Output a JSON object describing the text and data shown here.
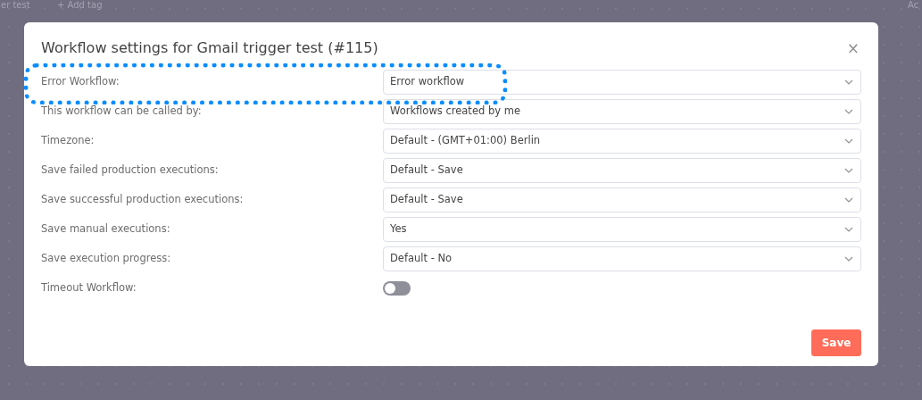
{
  "background": {
    "workflow_name": "er test",
    "add_tag": "+ Add tag",
    "right_action": "Ac"
  },
  "dialog": {
    "title": "Workflow settings for Gmail trigger test (#115)",
    "close": "×",
    "settings": [
      {
        "kind": "select",
        "label": "Error Workflow:",
        "value": "Error workflow",
        "highlighted": true
      },
      {
        "kind": "select",
        "label": "This workflow can be called by:",
        "value": "Workflows created by me",
        "highlighted": false
      },
      {
        "kind": "select",
        "label": "Timezone:",
        "value": "Default - (GMT+01:00) Berlin",
        "highlighted": false
      },
      {
        "kind": "select",
        "label": "Save failed production executions:",
        "value": "Default - Save",
        "highlighted": false
      },
      {
        "kind": "select",
        "label": "Save successful production executions:",
        "value": "Default - Save",
        "highlighted": false
      },
      {
        "kind": "select",
        "label": "Save manual executions:",
        "value": "Yes",
        "highlighted": false
      },
      {
        "kind": "select",
        "label": "Save execution progress:",
        "value": "Default - No",
        "highlighted": false
      },
      {
        "kind": "toggle",
        "label": "Timeout Workflow:",
        "on": false,
        "highlighted": false
      }
    ],
    "save_button": "Save"
  }
}
